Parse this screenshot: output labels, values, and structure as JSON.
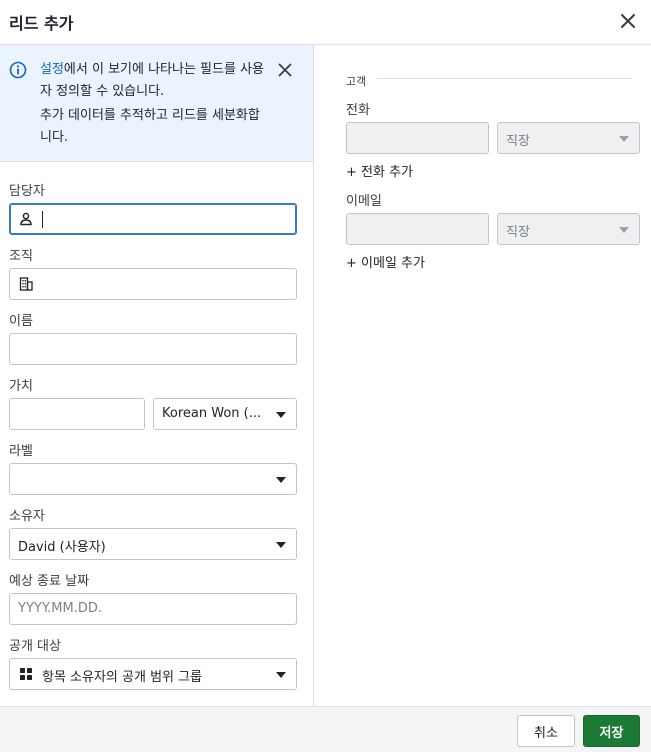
{
  "dialog": {
    "title": "리드 추가"
  },
  "banner": {
    "link_text": "설정",
    "line1_rest": "에서 이 보기에 나타나는 필드를 사용자 정의할 수 있습니다.",
    "line2": "추가 데이터를 추적하고 리드를 세분화합니다."
  },
  "form": {
    "contact_label": "담당자",
    "organization_label": "조직",
    "name_label": "이름",
    "value_label": "가치",
    "currency_value": "Korean Won (...",
    "label_label": "라벨",
    "owner_label": "소유자",
    "owner_value": "David (사용자)",
    "close_date_label": "예상 종료 날짜",
    "close_date_placeholder": "YYYY.MM.DD.",
    "visibility_label": "공개 대상",
    "visibility_value": "항목 소유자의 공개 범위 그룹"
  },
  "customer": {
    "section_title": "고객",
    "phone_label": "전화",
    "phone_type": "직장",
    "add_phone": "+ 전화 추가",
    "email_label": "이메일",
    "email_type": "직장",
    "add_email": "+ 이메일 추가"
  },
  "footer": {
    "cancel_label": "취소",
    "save_label": "저장"
  },
  "colors": {
    "accent_blue": "#1565c0",
    "save_green": "#1b7a34",
    "banner_bg": "#eaf3fe"
  },
  "icons": [
    "close-icon",
    "info-icon",
    "person-icon",
    "building-icon",
    "grid-icon",
    "chevron-down-icon"
  ]
}
